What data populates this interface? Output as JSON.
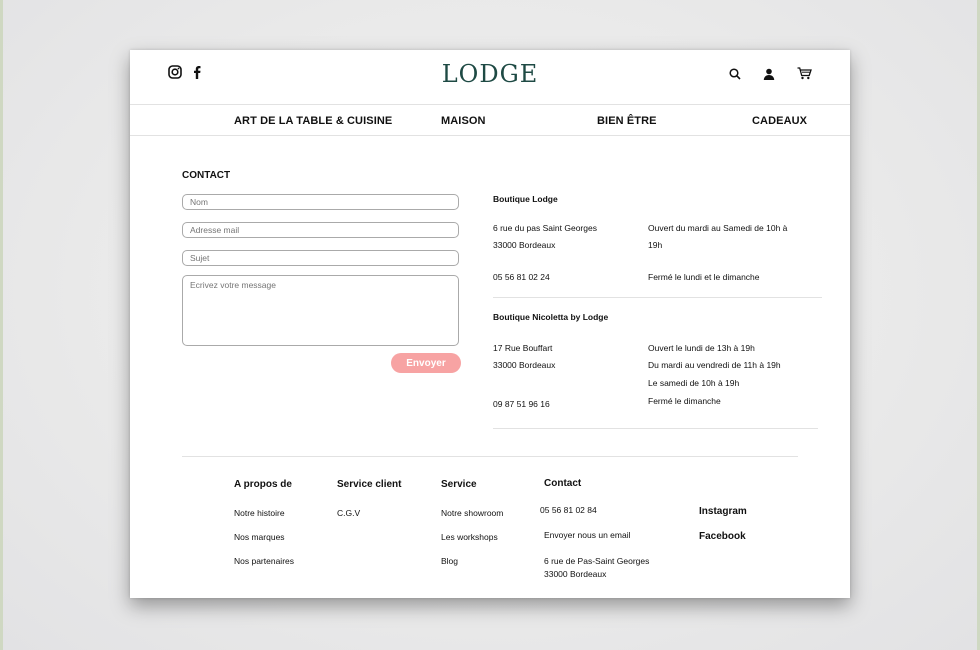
{
  "header": {
    "logo": "LODGE",
    "social": [
      "instagram-icon",
      "facebook-icon"
    ],
    "icons": [
      "search-icon",
      "user-icon",
      "cart-icon"
    ]
  },
  "nav": {
    "items": [
      "ART DE LA TABLE & CUISINE",
      "MAISON",
      "BIEN ÊTRE",
      "CADEAUX"
    ]
  },
  "contact": {
    "title": "CONTACT",
    "name_placeholder": "Nom",
    "email_placeholder": "Adresse mail",
    "subject_placeholder": "Sujet",
    "message_placeholder": "Ecrivez votre message",
    "send_label": "Envoyer",
    "send_color": "#f7a3a3"
  },
  "boutiques": [
    {
      "name": "Boutique Lodge",
      "address": [
        "6 rue du pas Saint Georges",
        "33000 Bordeaux"
      ],
      "phone": "05 56 81 02 24",
      "hours": [
        "Ouvert du mardi au Samedi de 10h à",
        "19h",
        "Fermé le lundi et le dimanche"
      ]
    },
    {
      "name": "Boutique Nicoletta by Lodge",
      "address": [
        "17 Rue Bouffart",
        "33000 Bordeaux"
      ],
      "phone": "09 87 51 96 16",
      "hours": [
        "Ouvert le lundi de 13h à 19h",
        "Du mardi au vendredi de 11h à 19h",
        "Le samedi de 10h à 19h",
        "Fermé le dimanche"
      ]
    }
  ],
  "footer": {
    "about": {
      "title": "A propos de",
      "links": [
        "Notre histoire",
        "Nos marques",
        "Nos partenaires"
      ]
    },
    "client": {
      "title": "Service client",
      "links": [
        "C.G.V"
      ]
    },
    "service": {
      "title": "Service",
      "links": [
        "Notre showroom",
        "Les workshops",
        "Blog"
      ]
    },
    "contact": {
      "title": "Contact",
      "phone": "05 56 81 02 84",
      "email_link": "Envoyer nous un email",
      "address": [
        "6 rue de Pas-Saint Georges",
        "33000 Bordeaux"
      ]
    },
    "social": [
      "Instagram",
      "Facebook"
    ]
  }
}
